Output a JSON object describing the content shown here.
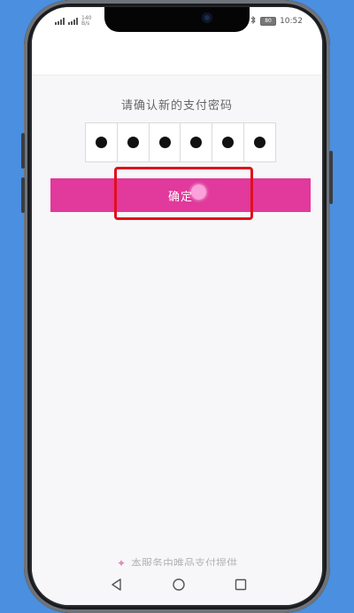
{
  "status_bar": {
    "network_label": "140",
    "network_unit": "B/s",
    "battery_level": "80",
    "time": "10:52"
  },
  "payment_password": {
    "prompt": "请确认新的支付密码",
    "digit_count": 6,
    "filled_count": 6,
    "confirm_label": "确定"
  },
  "footer": {
    "note": "本服务由唯品支付提供"
  },
  "colors": {
    "accent": "#e1399c",
    "highlight": "#e0101c",
    "background": "#4a8fe0"
  },
  "icons": {
    "back": "triangle-back-icon",
    "home": "circle-home-icon",
    "recent": "square-recent-icon"
  }
}
